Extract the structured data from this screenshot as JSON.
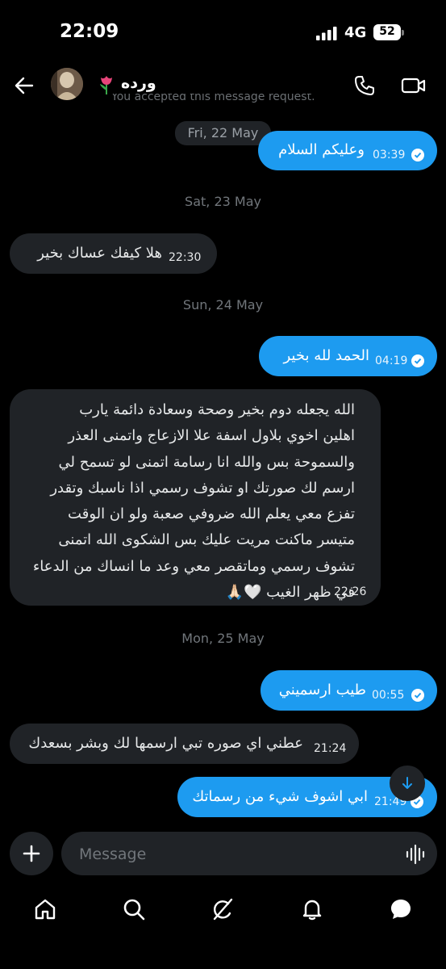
{
  "status": {
    "time": "22:09",
    "network": "4G",
    "battery": "52"
  },
  "header": {
    "contact_name": "ورده",
    "behind_text": "You accepted this message request."
  },
  "messages": [
    {
      "type": "date",
      "text": "Fri, 22 May"
    },
    {
      "type": "out",
      "text": "وعليكم السلام",
      "time": "03:39"
    },
    {
      "type": "date",
      "text": "Sat, 23 May"
    },
    {
      "type": "in",
      "text": "هلا كيفك عساك بخير",
      "time": "22:30"
    },
    {
      "type": "date",
      "text": "Sun, 24 May"
    },
    {
      "type": "out",
      "text": "الحمد لله بخير",
      "time": "04:19"
    },
    {
      "type": "in",
      "lines": [
        "الله يجعله دوم بخير وصحة وسعادة دائمة يارب",
        "اهلين  اخوي بلاول اسفة علا الازعاج واتمنى العذر",
        "والسموحة بس والله انا رسامة اتمنى لو تسمح لي",
        "ارسم لك صورتك او تشوف رسمي اذا ناسبك وتقدر",
        "تفزع معي يعلم الله ضروفي صعبة ولو ان الوقت",
        "متيسر ماكنت مريت عليك بس الشكوى الله اتمنى",
        "تشوف رسمي وماتقصر معي وعد ما انساك من الدعاء",
        "في ظهر الغيب 🤍🙏🏻"
      ],
      "time": "22:26"
    },
    {
      "type": "date",
      "text": "Mon, 25 May"
    },
    {
      "type": "out",
      "text": "طيب ارسميني",
      "time": "00:55"
    },
    {
      "type": "in",
      "text": "عطني اي صوره تبي ارسمها لك وبشر بسعدك",
      "time": "21:24"
    },
    {
      "type": "out",
      "text": "ابي اشوف شيء من رسماتك",
      "time": "21:49"
    }
  ],
  "composer": {
    "placeholder": "Message"
  },
  "colors": {
    "accent": "#1d9bf0",
    "incoming": "#202327",
    "background": "#000000"
  },
  "icons": {
    "back": "arrow-left-icon",
    "call": "phone-icon",
    "video": "video-camera-icon",
    "add": "plus-icon",
    "voice": "voice-wave-icon",
    "scroll": "arrow-down-icon",
    "nav": [
      "home-icon",
      "search-icon",
      "grok-icon",
      "bell-icon",
      "messages-icon"
    ]
  }
}
